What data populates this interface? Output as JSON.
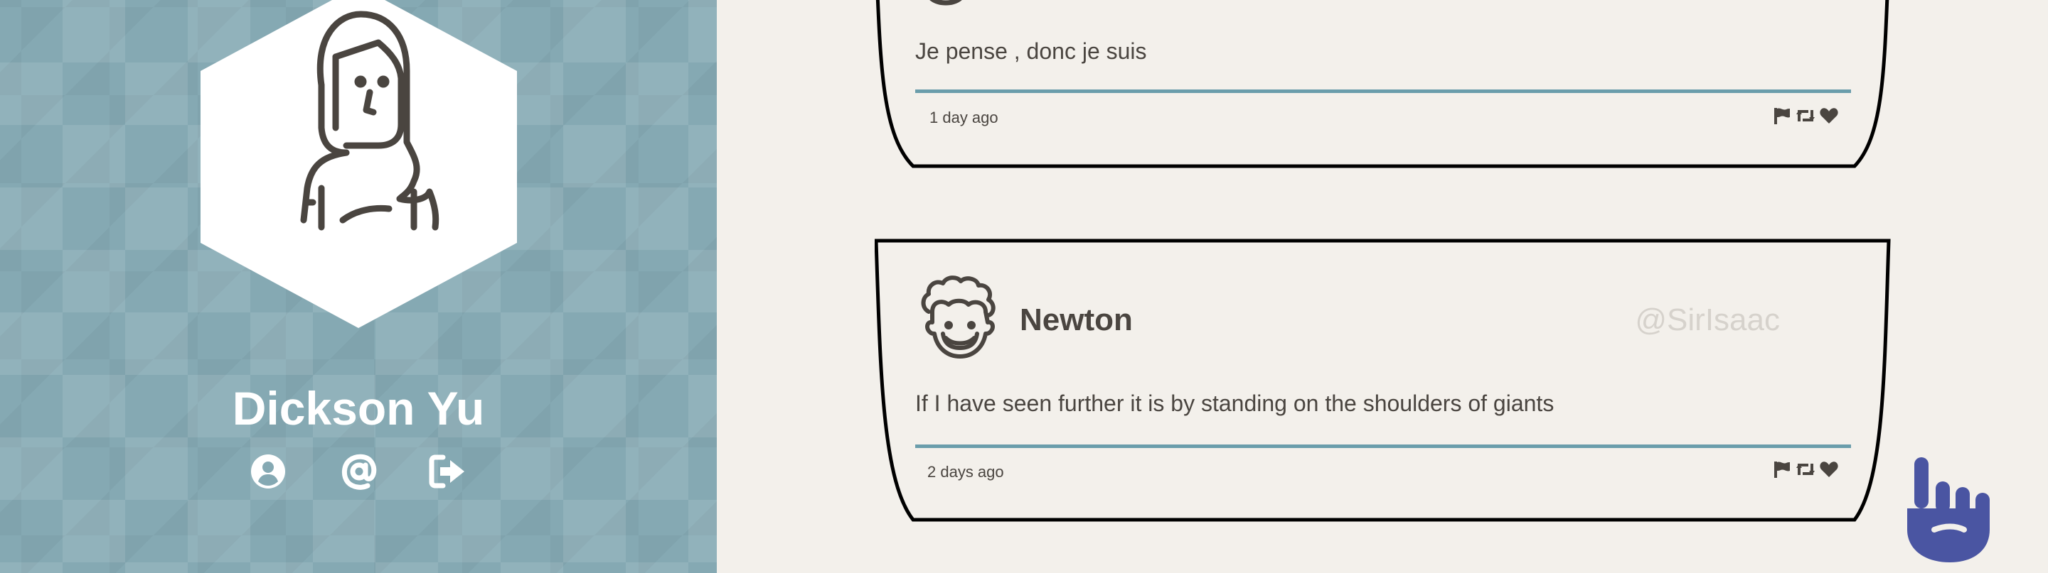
{
  "profile": {
    "name": "Dickson Yu",
    "icons": [
      "user-circle-icon",
      "at-icon",
      "sign-out-icon"
    ]
  },
  "posts": [
    {
      "author": "",
      "handle": "",
      "message": "Je pense , donc je suis",
      "time": "1 day ago"
    },
    {
      "author": "Newton",
      "handle": "@SirIsaac",
      "message": "If I have seen further it is by standing on the shoulders of giants",
      "time": "2 days ago"
    }
  ],
  "post_action_icons": [
    "flag-icon",
    "retweet-icon",
    "heart-icon"
  ],
  "colors": {
    "sidebar": "#85a9b3",
    "background": "#f3f0eb",
    "divider": "#6a9dab",
    "text": "#4a4540",
    "handle": "#d6d2cc",
    "fab": "#4a55a2"
  }
}
